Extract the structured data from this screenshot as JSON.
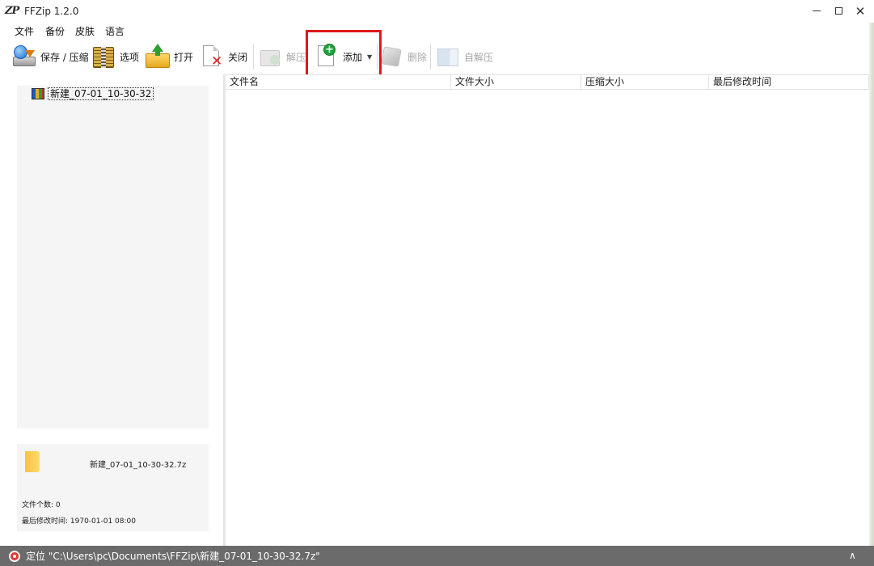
{
  "window": {
    "logo_text": "ZP",
    "title": "FFZip 1.2.0",
    "min_icon": "minimize-icon",
    "max_icon": "maximize-icon",
    "close_glyph": "✕"
  },
  "menu": [
    "文件",
    "备份",
    "皮肤",
    "语言"
  ],
  "toolbar": {
    "save": {
      "label": "保存 / 压缩",
      "icon": "save-compress-icon",
      "enabled": true
    },
    "options": {
      "label": "选项",
      "icon": "options-icon",
      "enabled": true
    },
    "open": {
      "label": "打开",
      "icon": "open-folder-icon",
      "enabled": true
    },
    "close": {
      "label": "关闭",
      "icon": "close-document-icon",
      "enabled": true
    },
    "extract": {
      "label": "解压",
      "icon": "extract-icon",
      "enabled": false
    },
    "add": {
      "label": "添加",
      "icon": "add-file-icon",
      "enabled": true,
      "dropdown_glyph": "▼"
    },
    "delete": {
      "label": "删除",
      "icon": "delete-icon",
      "enabled": false
    },
    "sfx": {
      "label": "自解压",
      "icon": "self-extract-icon",
      "enabled": false
    }
  },
  "tree": {
    "items": [
      {
        "label": "新建_07-01_10-30-32",
        "icon": "archive-icon"
      }
    ]
  },
  "info": {
    "filename": "新建_07-01_10-30-32.7z",
    "file_count": "文件个数: 0",
    "last_modified": "最后修改时间: 1970-01-01 08:00"
  },
  "file_list": {
    "columns": [
      "文件名",
      "文件大小",
      "压缩大小",
      "最后修改时间"
    ],
    "rows": []
  },
  "status": {
    "text": "定位 \"C:\\Users\\pc\\Documents\\FFZip\\新建_07-01_10-30-32.7z\"",
    "grip_glyph": "∧"
  },
  "colors": {
    "highlight": "#e01818",
    "statusbar": "#6b6b6b",
    "disabled_text": "#a8a8a8"
  }
}
